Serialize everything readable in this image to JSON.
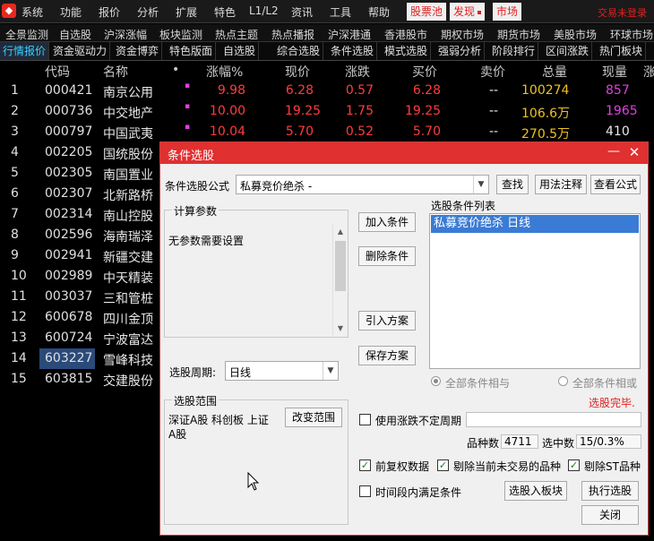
{
  "menubar": {
    "items": [
      "系统",
      "功能",
      "报价",
      "分析",
      "扩展",
      "特色",
      "L1/L2",
      "资讯",
      "工具",
      "帮助"
    ],
    "hot": [
      "股票池",
      "发现",
      "市场"
    ],
    "brand": "交易未登录"
  },
  "nav2": [
    "全景监测",
    "自选股",
    "沪深涨幅",
    "板块监测",
    "热点主题",
    "热点播报",
    "沪深港通",
    "香港股市",
    "期权市场",
    "期货市场",
    "美股市场",
    "环球市场"
  ],
  "tabs": [
    "行情报价",
    "资金驱动力",
    "资金博弈",
    "特色版面",
    "自选股",
    "综合选股",
    "条件选股",
    "模式选股",
    "强弱分析",
    "阶段排行",
    "区间涨跌",
    "热门板块"
  ],
  "table": {
    "headers": [
      "代码",
      "名称",
      "•",
      "涨幅%",
      "现价",
      "涨跌",
      "买价",
      "卖价",
      "总量",
      "现量",
      "涨"
    ],
    "rows": [
      {
        "idx": "1",
        "code": "000421",
        "name": "南京公用",
        "mark": "▪",
        "pct": "9.98",
        "price": "6.28",
        "chg": "0.57",
        "bid": "6.28",
        "ask": "--",
        "vol": "100274",
        "cur": "857",
        "cur_color": "magenta"
      },
      {
        "idx": "2",
        "code": "000736",
        "name": "中交地产",
        "mark": "▪",
        "pct": "10.00",
        "price": "19.25",
        "chg": "1.75",
        "bid": "19.25",
        "ask": "--",
        "vol": "106.6万",
        "cur": "1965",
        "cur_color": "magenta"
      },
      {
        "idx": "3",
        "code": "000797",
        "name": "中国武夷",
        "mark": "▪",
        "pct": "10.04",
        "price": "5.70",
        "chg": "0.52",
        "bid": "5.70",
        "ask": "--",
        "vol": "270.5万",
        "cur": "410",
        "cur_color": "white"
      },
      {
        "idx": "4",
        "code": "002205",
        "name": "国统股份"
      },
      {
        "idx": "5",
        "code": "002305",
        "name": "南国置业"
      },
      {
        "idx": "6",
        "code": "002307",
        "name": "北新路桥"
      },
      {
        "idx": "7",
        "code": "002314",
        "name": "南山控股"
      },
      {
        "idx": "8",
        "code": "002596",
        "name": "海南瑞泽"
      },
      {
        "idx": "9",
        "code": "002941",
        "name": "新疆交建"
      },
      {
        "idx": "10",
        "code": "002989",
        "name": "中天精装"
      },
      {
        "idx": "11",
        "code": "003037",
        "name": "三和管桩"
      },
      {
        "idx": "12",
        "code": "600678",
        "name": "四川金顶"
      },
      {
        "idx": "13",
        "code": "600724",
        "name": "宁波富达"
      },
      {
        "idx": "14",
        "code": "603227",
        "name": "雪峰科技",
        "selected": true
      },
      {
        "idx": "15",
        "code": "603815",
        "name": "交建股份"
      }
    ]
  },
  "dialog": {
    "title": "条件选股",
    "formula_label": "条件选股公式",
    "formula_value": "私募竞价绝杀 -",
    "btn_find": "查找",
    "btn_usage": "用法注释",
    "btn_view": "查看公式",
    "params_group": "计算参数",
    "params_text": "无参数需要设置",
    "btn_add": "加入条件",
    "btn_del": "删除条件",
    "btn_load": "引入方案",
    "btn_save": "保存方案",
    "list_label": "选股条件列表",
    "list_item": "私募竞价绝杀  日线",
    "period_label": "选股周期:",
    "period_value": "日线",
    "radio_and": "全部条件相与",
    "radio_or": "全部条件相或",
    "done_text": "选股完毕.",
    "range_group": "选股范围",
    "range_text_1": "深证A股 科创板 上证",
    "range_text_2": "A股",
    "btn_range": "改变范围",
    "chk_uncertain": "使用涨跌不定周期",
    "count_label": "品种数",
    "count_value": "4711",
    "selected_label": "选中数",
    "selected_value": "15/0.3%",
    "chk_adjust": "前复权数据",
    "chk_exclude_nontrade": "剔除当前未交易的品种",
    "chk_exclude_st": "剔除ST品种",
    "chk_time": "时间段内满足条件",
    "btn_to_block": "选股入板块",
    "btn_run": "执行选股",
    "btn_close": "关闭"
  },
  "colors": {
    "accent_red": "#e03030",
    "up_red": "#ff3c3c",
    "selection_blue": "#3a7bd5"
  }
}
